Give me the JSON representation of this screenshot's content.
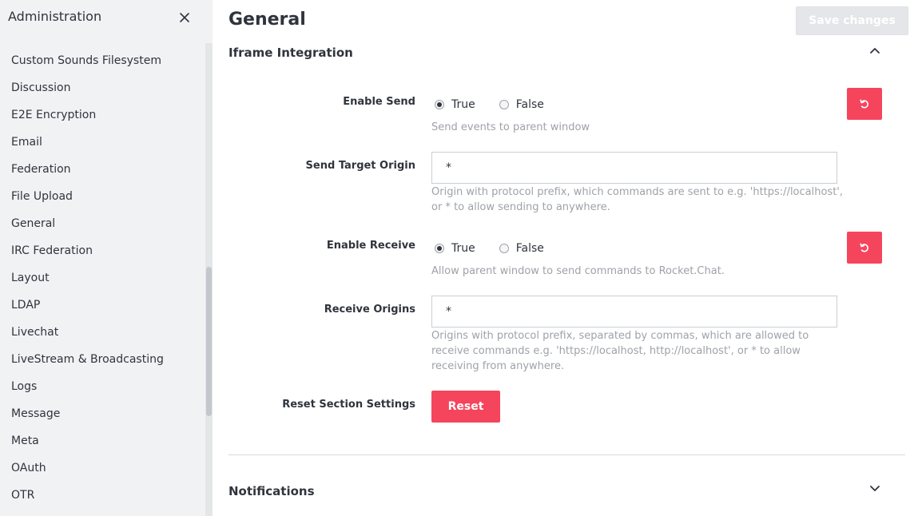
{
  "sidebar": {
    "title": "Administration",
    "items": [
      {
        "label": "Custom Sounds Filesystem"
      },
      {
        "label": "Discussion"
      },
      {
        "label": "E2E Encryption"
      },
      {
        "label": "Email"
      },
      {
        "label": "Federation"
      },
      {
        "label": "File Upload"
      },
      {
        "label": "General"
      },
      {
        "label": "IRC Federation"
      },
      {
        "label": "Layout"
      },
      {
        "label": "LDAP"
      },
      {
        "label": "Livechat"
      },
      {
        "label": "LiveStream & Broadcasting"
      },
      {
        "label": "Logs"
      },
      {
        "label": "Message"
      },
      {
        "label": "Meta"
      },
      {
        "label": "OAuth"
      },
      {
        "label": "OTR"
      }
    ]
  },
  "main": {
    "title": "General",
    "save_label": "Save changes",
    "sections": [
      {
        "title": "Iframe Integration",
        "expanded": true,
        "fields": {
          "enable_send": {
            "label": "Enable Send",
            "options": [
              "True",
              "False"
            ],
            "selected": "True",
            "hint": "Send events to parent window"
          },
          "send_target_origin": {
            "label": "Send Target Origin",
            "value": "*",
            "hint": "Origin with protocol prefix, which commands are sent to e.g. 'https://localhost', or * to allow sending to anywhere."
          },
          "enable_receive": {
            "label": "Enable Receive",
            "options": [
              "True",
              "False"
            ],
            "selected": "True",
            "hint": "Allow parent window to send commands to Rocket.Chat."
          },
          "receive_origins": {
            "label": "Receive Origins",
            "value": "*",
            "hint": "Origins with protocol prefix, separated by commas, which are allowed to receive commands e.g. 'https://localhost, http://localhost', or * to allow receiving from anywhere."
          },
          "reset_section": {
            "label": "Reset Section Settings",
            "button_label": "Reset"
          }
        }
      },
      {
        "title": "Notifications",
        "expanded": false
      }
    ]
  },
  "colors": {
    "accent_red": "#f5455c",
    "sidebar_bg": "#f1f2f4",
    "hint_text": "#9ea2a8",
    "save_disabled_bg": "#e4e6e9"
  },
  "icons": {
    "close": "close-icon",
    "collapse": "chevron-up-icon",
    "expand": "chevron-down-icon",
    "reset": "undo-icon"
  }
}
